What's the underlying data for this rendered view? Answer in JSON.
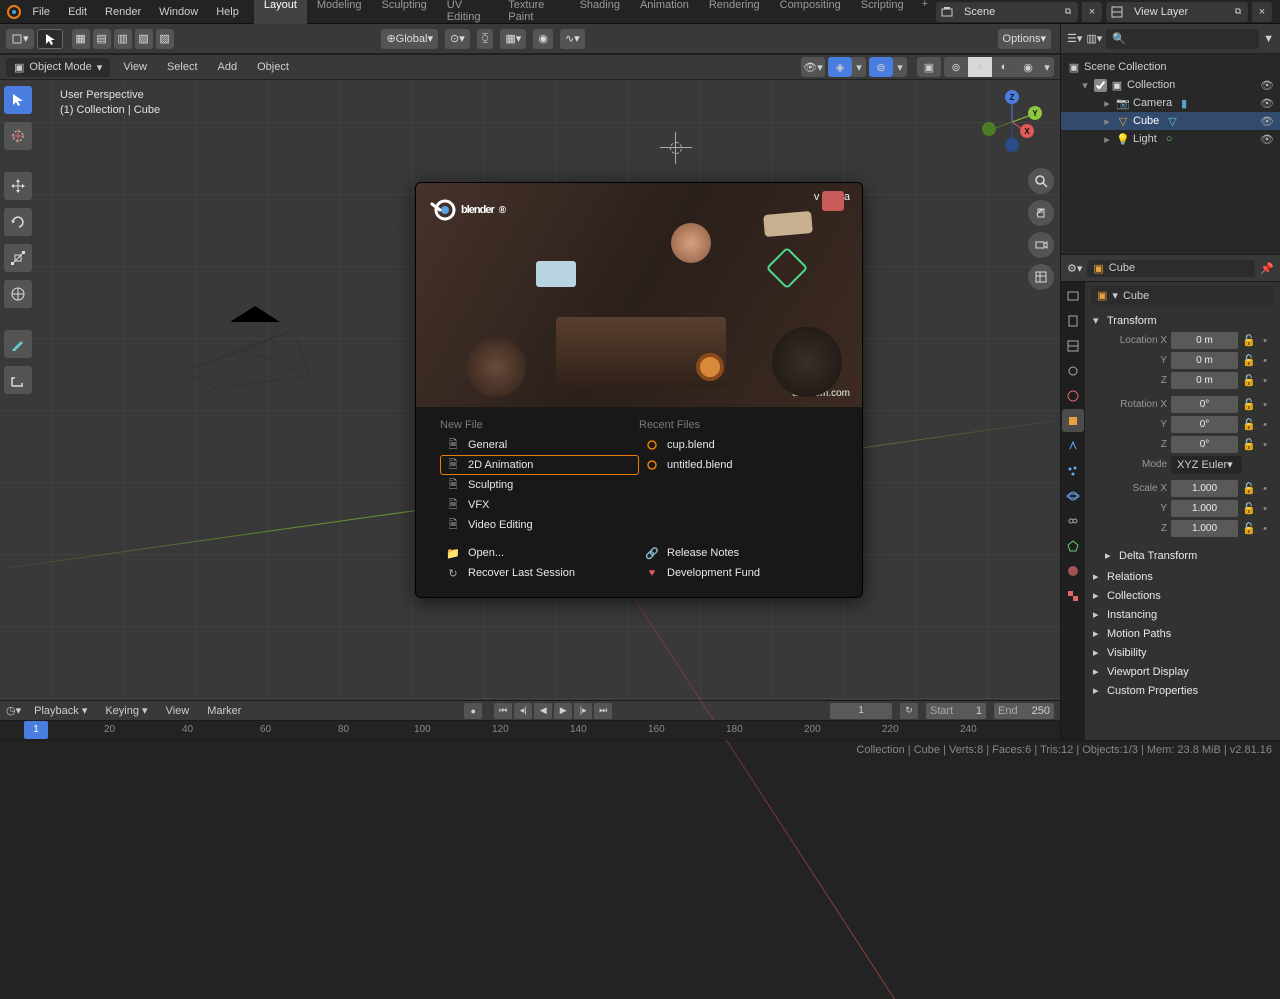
{
  "menus": {
    "file": "File",
    "edit": "Edit",
    "render": "Render",
    "window": "Window",
    "help": "Help"
  },
  "workspace_tabs": [
    "Layout",
    "Modeling",
    "Sculpting",
    "UV Editing",
    "Texture Paint",
    "Shading",
    "Animation",
    "Rendering",
    "Compositing",
    "Scripting"
  ],
  "active_tab": 0,
  "scene_name": "Scene",
  "view_layer_name": "View Layer",
  "header3d": {
    "orientation": "Global",
    "options": "Options"
  },
  "mode_header": {
    "mode": "Object Mode",
    "menus": [
      "View",
      "Select",
      "Add",
      "Object"
    ]
  },
  "viewport_info": {
    "perspective": "User Perspective",
    "collection": "(1) Collection | Cube"
  },
  "outliner": {
    "root": "Scene Collection",
    "collection": "Collection",
    "items": [
      {
        "name": "Camera",
        "type": "camera"
      },
      {
        "name": "Cube",
        "type": "mesh",
        "selected": true
      },
      {
        "name": "Light",
        "type": "light"
      }
    ]
  },
  "properties": {
    "object": "Cube",
    "data": "Cube",
    "transform_heading": "Transform",
    "loc_label": "Location X",
    "locx": "0 m",
    "locy": "0 m",
    "locz": "0 m",
    "rot_label": "Rotation X",
    "rotx": "0°",
    "roty": "0°",
    "rotz": "0°",
    "mode_label": "Mode",
    "mode_value": "XYZ Euler",
    "scale_label": "Scale X",
    "sx": "1.000",
    "sy": "1.000",
    "sz": "1.000",
    "sections": [
      "Delta Transform",
      "Relations",
      "Collections",
      "Instancing",
      "Motion Paths",
      "Visibility",
      "Viewport Display",
      "Custom Properties"
    ]
  },
  "splash": {
    "title": "blender",
    "version": "v 2.81a",
    "credit": "aendom.com",
    "new_file_heading": "New File",
    "new_file": [
      "General",
      "2D Animation",
      "Sculpting",
      "VFX",
      "Video Editing"
    ],
    "selected_new_file": 1,
    "open": "Open...",
    "recover": "Recover Last Session",
    "recent_heading": "Recent Files",
    "recent": [
      "cup.blend",
      "untitled.blend"
    ],
    "notes": "Release Notes",
    "fund": "Development Fund"
  },
  "timeline": {
    "playback": "Playback",
    "keying": "Keying",
    "view": "View",
    "marker": "Marker",
    "current": "1",
    "start_label": "Start",
    "start": "1",
    "end_label": "End",
    "end": "250",
    "ruler": [
      20,
      40,
      60,
      80,
      100,
      120,
      140,
      160,
      180,
      200,
      220,
      240
    ]
  },
  "status": "Collection | Cube | Verts:8 | Faces:6 | Tris:12 | Objects:1/3 | Mem: 23.8 MiB | v2.81.16",
  "axes": {
    "x": "X",
    "y": "Y",
    "z": "Z"
  }
}
